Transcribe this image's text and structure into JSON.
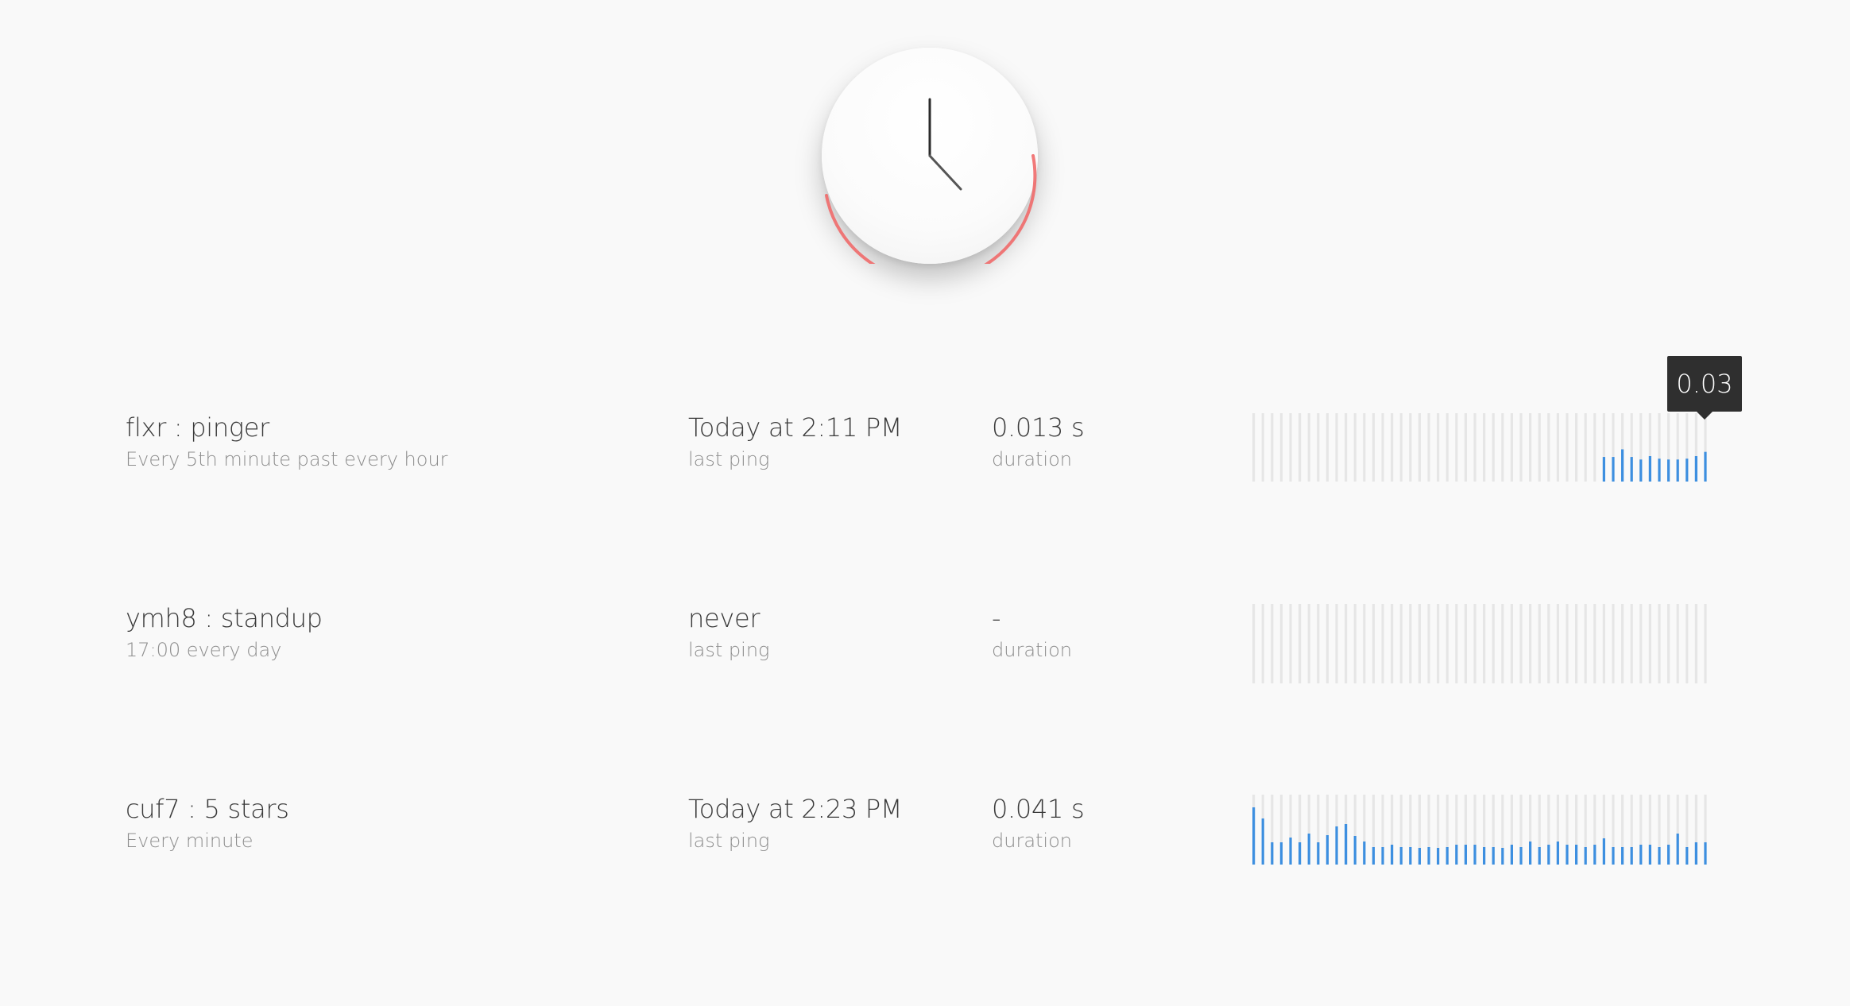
{
  "clock": {
    "hour_hand_label": "clock hour hand",
    "minute_hand_label": "clock minute hand"
  },
  "checks": [
    {
      "name": "flxr : pinger",
      "schedule": "Every 5th minute past every hour",
      "last_ping_value": "Today at 2:11 PM",
      "last_ping_label": "last ping",
      "duration_value": "0.013 s",
      "duration_label": "duration",
      "bars": [
        0,
        0,
        0,
        0,
        0,
        0,
        0,
        0,
        0,
        0,
        0,
        0,
        0,
        0,
        0,
        0,
        0,
        0,
        0,
        0,
        0,
        0,
        0,
        0,
        0,
        0,
        0,
        0,
        0,
        0,
        0,
        0,
        0,
        0,
        0,
        0,
        0,
        0,
        0.0145,
        0.0145,
        0.019,
        0.0145,
        0.013,
        0.015,
        0.0135,
        0.013,
        0.013,
        0.0135,
        0.015,
        0.0175,
        0.03
      ]
    },
    {
      "name": "ymh8 : standup",
      "schedule": "17:00 every day",
      "last_ping_value": "never",
      "last_ping_label": "last ping",
      "duration_value": "-",
      "duration_label": "duration",
      "bars": [
        0,
        0,
        0,
        0,
        0,
        0,
        0,
        0,
        0,
        0,
        0,
        0,
        0,
        0,
        0,
        0,
        0,
        0,
        0,
        0,
        0,
        0,
        0,
        0,
        0,
        0,
        0,
        0,
        0,
        0,
        0,
        0,
        0,
        0,
        0,
        0,
        0,
        0,
        0,
        0,
        0,
        0,
        0,
        0,
        0,
        0,
        0,
        0,
        0,
        0,
        0
      ]
    },
    {
      "name": "cuf7 : 5 stars",
      "schedule": "Every minute",
      "last_ping_value": "Today at 2:23 PM",
      "last_ping_label": "last ping",
      "duration_value": "0.041 s",
      "duration_label": "duration",
      "bars": [
        0.072,
        0.058,
        0.028,
        0.028,
        0.034,
        0.028,
        0.039,
        0.028,
        0.037,
        0.048,
        0.051,
        0.036,
        0.029,
        0.022,
        0.022,
        0.025,
        0.022,
        0.022,
        0.021,
        0.022,
        0.021,
        0.022,
        0.025,
        0.025,
        0.025,
        0.022,
        0.022,
        0.021,
        0.025,
        0.022,
        0.029,
        0.022,
        0.025,
        0.029,
        0.025,
        0.025,
        0.022,
        0.025,
        0.033,
        0.022,
        0.022,
        0.022,
        0.025,
        0.025,
        0.022,
        0.025,
        0.039,
        0.022,
        0.028,
        0.028,
        0.025
      ]
    }
  ],
  "tooltip": {
    "value": "0.03"
  },
  "colors": {
    "bar_active": "#3d8fe0",
    "bar_empty": "#e6e6e6",
    "clock_arc": "#ef6a6a"
  }
}
